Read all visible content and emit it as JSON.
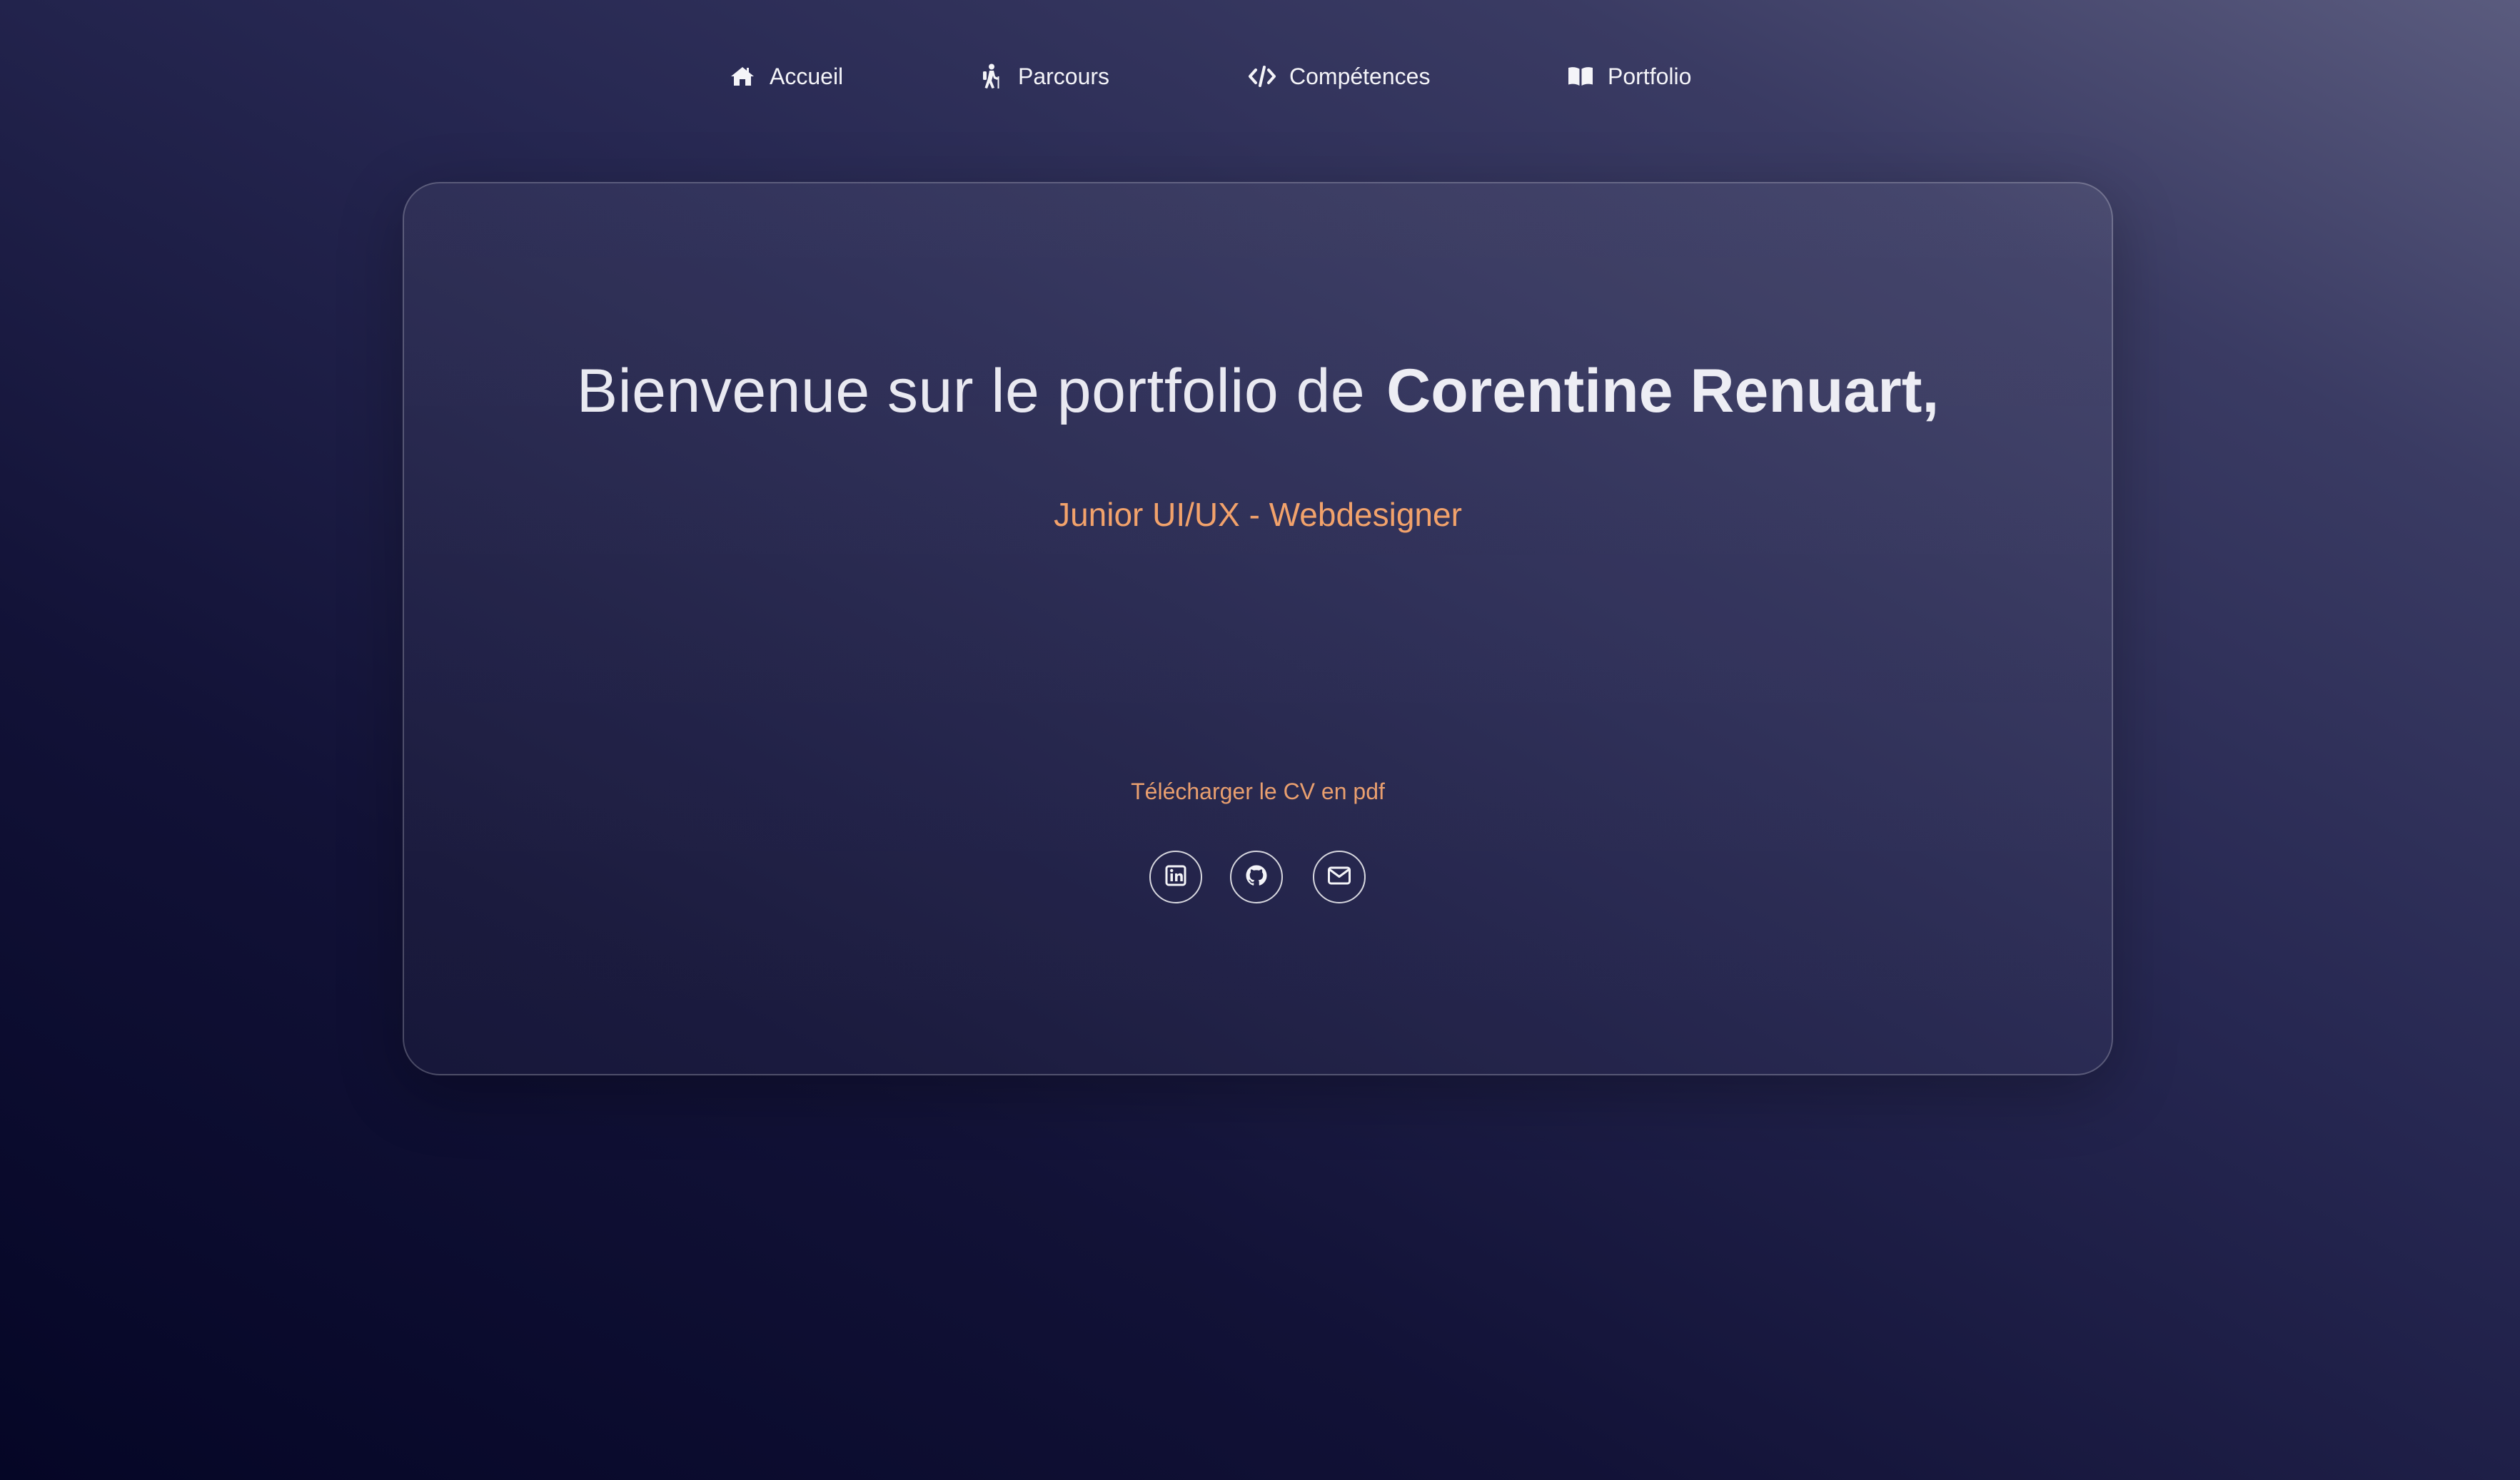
{
  "nav": {
    "items": [
      {
        "label": "Accueil",
        "icon": "home-icon"
      },
      {
        "label": "Parcours",
        "icon": "hiking-icon"
      },
      {
        "label": "Compétences",
        "icon": "code-icon"
      },
      {
        "label": "Portfolio",
        "icon": "book-open-icon"
      }
    ]
  },
  "hero": {
    "intro": "Bienvenue sur le portfolio de",
    "name": "Corentine Renuart,",
    "subtitle": "Junior UI/UX - Webdesigner",
    "download_label": "Télécharger le CV en pdf"
  },
  "socials": [
    {
      "icon": "linkedin-icon"
    },
    {
      "icon": "github-icon"
    },
    {
      "icon": "email-icon"
    }
  ],
  "colors": {
    "accent": "#f2a26b",
    "text": "#f4f4f8",
    "background_dark": "#050626",
    "background_light": "#5a5b7e"
  }
}
